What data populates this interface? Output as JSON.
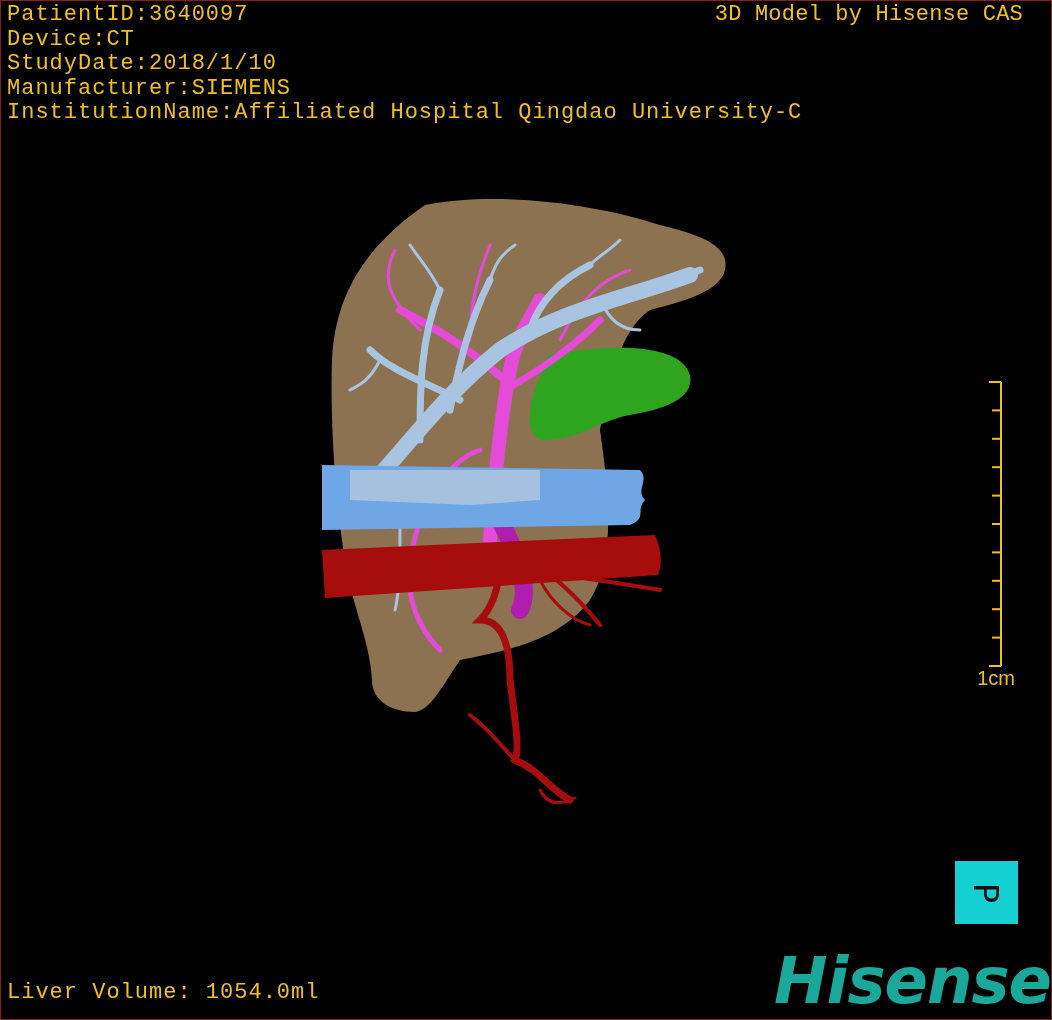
{
  "patient_info": [
    "PatientID:3640097",
    "Device:CT",
    "StudyDate:2018/1/10",
    "Manufacturer:SIEMENS",
    "InstitutionName:Affiliated Hospital Qingdao University-C"
  ],
  "credit": "3D Model by Hisense CAS",
  "scale_bar": {
    "label": "1cm"
  },
  "orientation_marker": {
    "label": "P"
  },
  "liver_volume": "Liver Volume: 1054.0ml",
  "logo": "Hisense"
}
